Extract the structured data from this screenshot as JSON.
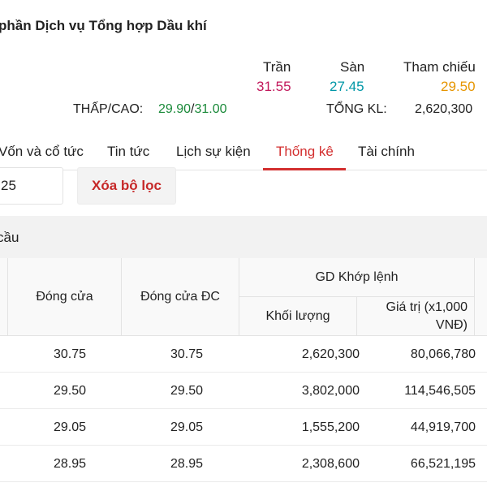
{
  "company_name": "phần Dịch vụ Tổng hợp Dầu khí",
  "price_ref": {
    "ceiling_label": "Trần",
    "ceiling_value": "31.55",
    "floor_label": "Sàn",
    "floor_value": "27.45",
    "reference_label": "Tham chiếu",
    "reference_value": "29.50",
    "colors": {
      "ceiling": "#c2185b",
      "floor": "#0097a7",
      "reference": "#e69500",
      "up": "#1b8a3a"
    }
  },
  "low_high": {
    "label": "THẤP/CAO:",
    "low": "29.90",
    "separator": "/",
    "high": "31.00"
  },
  "total_volume": {
    "label": "TỔNG KL:",
    "value": "2,620,300"
  },
  "tabs": [
    {
      "label": "Vốn và cổ tức"
    },
    {
      "label": "Tin tức"
    },
    {
      "label": "Lịch sự kiện"
    },
    {
      "label": "Thống kê",
      "active": true
    },
    {
      "label": "Tài chính"
    }
  ],
  "filter": {
    "date_value": "25",
    "clear_label": "Xóa bộ lọc"
  },
  "section": {
    "title": "cầu"
  },
  "table": {
    "headers": {
      "close": "Đóng cửa",
      "close_adj": "Đóng cửa ĐC",
      "matched_group": "GD Khớp lệnh",
      "volume": "Khối lượng",
      "value": "Giá trị (x1,000 VNĐ)"
    },
    "rows": [
      {
        "close": "30.75",
        "close_adj": "30.75",
        "volume": "2,620,300",
        "value": "80,066,780"
      },
      {
        "close": "29.50",
        "close_adj": "29.50",
        "volume": "3,802,000",
        "value": "114,546,505"
      },
      {
        "close": "29.05",
        "close_adj": "29.05",
        "volume": "1,555,200",
        "value": "44,919,700"
      },
      {
        "close": "28.95",
        "close_adj": "28.95",
        "volume": "2,308,600",
        "value": "66,521,195"
      }
    ]
  }
}
